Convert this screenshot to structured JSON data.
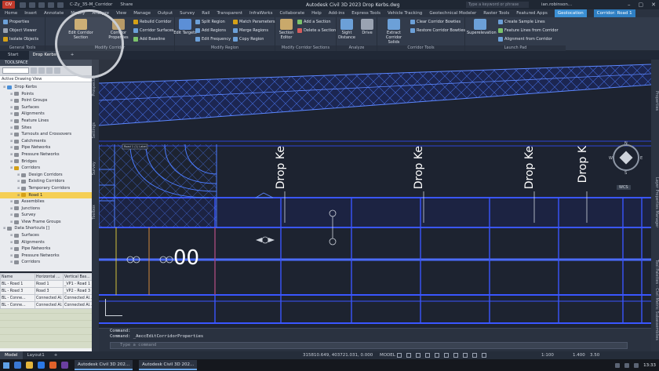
{
  "titlebar": {
    "app_badge": "CIV",
    "file_combo": "C-Zy_35-M_Corridor",
    "share": "Share",
    "window_title": "Autodesk Civil 3D 2023    Drop Kerbs.dwg",
    "search_placeholder": "Type a keyword or phrase",
    "user": "ian.robinson..."
  },
  "ribbon_tabs": [
    "Home",
    "Insert",
    "Annotate",
    "Modify",
    "Analyze",
    "View",
    "Manage",
    "Output",
    "Survey",
    "Rail",
    "Transparent",
    "InfraWorks",
    "Collaborate",
    "Help",
    "Add-ins",
    "Express Tools",
    "Vehicle Tracking",
    "Geotechnical Modeler",
    "Raster Tools",
    "Featured Apps",
    "Geolocation",
    "Corridor: Road 1"
  ],
  "ribbon": {
    "general_tools": {
      "title": "General Tools",
      "items": [
        "Properties",
        "Object Viewer",
        "Isolate Objects"
      ]
    },
    "modify_corridor": {
      "title": "Modify Corridor",
      "edit_corridor_section": "Edit Corridor Section",
      "corridor_properties": "Corridor Properties",
      "rebuild_corridor": "Rebuild Corridor",
      "corridor_surfaces": "Corridor Surfaces",
      "add_baseline": "Add Baseline"
    },
    "modify_region": {
      "title": "Modify Region",
      "edit_targets": "Edit Targets",
      "split_region": "Split Region",
      "add_regions": "Add Regions",
      "edit_frequency": "Edit Frequency",
      "match_parameters": "Match Parameters",
      "merge_regions": "Merge Regions",
      "copy_region": "Copy Region"
    },
    "modify_sections": {
      "title": "Modify Corridor Sections",
      "section_editor": "Section Editor",
      "add_section": "Add a Section",
      "delete_section": "Delete a Section"
    },
    "analyze": {
      "title": "Analyze",
      "sight_distance": "Sight Distance",
      "drive": "Drive"
    },
    "corridor_tools": {
      "title": "Corridor Tools",
      "extract_solids": "Extract Corridor Solids",
      "clear_bowties": "Clear Corridor Bowties",
      "restore_bowties": "Restore Corridor Bowties"
    },
    "launch_pad": {
      "title": "Launch Pad",
      "superelevation": "Superelevation",
      "create_sample_lines": "Create Sample Lines",
      "feature_lines_from_corridor": "Feature Lines from Corridor",
      "alignment_from_corridor": "Alignment from Corridor"
    }
  },
  "doc_tabs": [
    "Start",
    "Drop Kerbs"
  ],
  "toolspace": {
    "header": "TOOLSPACE",
    "view": "Active Drawing View",
    "tree": [
      {
        "label": "Drop Kerbs",
        "level": 0,
        "color": "#4a8fd8"
      },
      {
        "label": "Points",
        "level": 1,
        "color": "#8b8f97"
      },
      {
        "label": "Point Groups",
        "level": 1,
        "color": "#8b8f97"
      },
      {
        "label": "Surfaces",
        "level": 1,
        "color": "#8b8f97"
      },
      {
        "label": "Alignments",
        "level": 1,
        "color": "#8b8f97"
      },
      {
        "label": "Feature Lines",
        "level": 1,
        "color": "#8b8f97"
      },
      {
        "label": "Sites",
        "level": 1,
        "color": "#8b8f97"
      },
      {
        "label": "Turnouts and Crossovers",
        "level": 1,
        "color": "#8b8f97"
      },
      {
        "label": "Catchments",
        "level": 1,
        "color": "#8b8f97"
      },
      {
        "label": "Pipe Networks",
        "level": 1,
        "color": "#8b8f97"
      },
      {
        "label": "Pressure Networks",
        "level": 1,
        "color": "#8b8f97"
      },
      {
        "label": "Bridges",
        "level": 1,
        "color": "#8b8f97"
      },
      {
        "label": "Corridors",
        "level": 1,
        "color": "#d4a017"
      },
      {
        "label": "Design Corridors",
        "level": 2,
        "color": "#8b8f97"
      },
      {
        "label": "Existing Corridors",
        "level": 2,
        "color": "#8b8f97"
      },
      {
        "label": "Temporary Corridors",
        "level": 2,
        "color": "#8b8f97"
      },
      {
        "label": "Road 1",
        "level": 2,
        "color": "#d4a017",
        "selected": true
      },
      {
        "label": "Assemblies",
        "level": 1,
        "color": "#8b8f97"
      },
      {
        "label": "Junctions",
        "level": 1,
        "color": "#8b8f97"
      },
      {
        "label": "Survey",
        "level": 1,
        "color": "#8b8f97"
      },
      {
        "label": "View Frame Groups",
        "level": 1,
        "color": "#8b8f97"
      },
      {
        "label": "Data Shortcuts []",
        "level": 0,
        "color": "#8b8f97"
      },
      {
        "label": "Surfaces",
        "level": 1,
        "color": "#8b8f97"
      },
      {
        "label": "Alignments",
        "level": 1,
        "color": "#8b8f97"
      },
      {
        "label": "Pipe Networks",
        "level": 1,
        "color": "#8b8f97"
      },
      {
        "label": "Pressure Networks",
        "level": 1,
        "color": "#8b8f97"
      },
      {
        "label": "Corridors",
        "level": 1,
        "color": "#8b8f97"
      }
    ]
  },
  "grid": {
    "headers": [
      "Name",
      "Horizontal ...",
      "Vertical Bas..."
    ],
    "rows": [
      [
        "BL - Road 1",
        "Road 1",
        "_VP1 - Road 1"
      ],
      [
        "BL - Road 3",
        "Road 3",
        "_VP2 - Road 3"
      ],
      [
        "BL - Conne...",
        "Connected Al...",
        "Connected Al..."
      ],
      [
        "BL - Conne...",
        "Connected Al...",
        "Connected Al..."
      ]
    ]
  },
  "side_palettes": {
    "left": [
      "Prospector",
      "Settings",
      "Survey",
      "Toolbox"
    ],
    "right": [
      "Properties",
      "Layer Properties Manager",
      "Tool Palettes - Civil Metric Subassemblies"
    ]
  },
  "viewport": {
    "labels": [
      "Drop Ke",
      "Drop Ke",
      "Drop Ke",
      "Drop K"
    ],
    "station_text": "00",
    "small_tag": "Road 1 (1) Label",
    "viewcube": {
      "n": "N",
      "s": "S",
      "e": "E",
      "w": "W",
      "wcs": "WCS"
    }
  },
  "command": {
    "history": [
      "Command:",
      "Command:  _AeccEditCorridorProperties"
    ],
    "placeholder": "Type a command"
  },
  "statusbar": {
    "tabs": [
      "Model",
      "Layout1"
    ],
    "coords": "315810.649, 403721.031, 0.000",
    "model": "MODEL",
    "scale": "1:100",
    "scale2": "1.400",
    "values": "3.50"
  },
  "taskbar": {
    "tasks": [
      "Autodesk Civil 3D 202...",
      "Autodesk Civil 3D 202..."
    ],
    "time": "13:33"
  },
  "colors": {
    "corridor_lines": "#2d45d6",
    "corridor_lines_light": "#4c7bff",
    "label_white": "#ffffff",
    "accent_blue": "#3b8fd4",
    "selected_tree": "#f5cf55"
  }
}
